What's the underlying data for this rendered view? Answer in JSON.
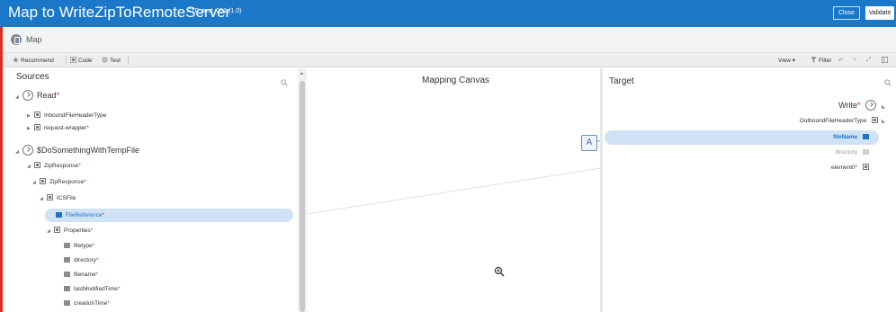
{
  "header": {
    "title": "Map to WriteZipToRemoteServer",
    "subtitle": "FTP_test_001 (1.0)",
    "close_label": "Close",
    "validate_label": "Validate",
    "accent_color": "#1b78c9"
  },
  "mapbar": {
    "label": "Map",
    "icon": "map-icon"
  },
  "toolbar": {
    "recommend": "Recommend",
    "code": "Code",
    "test": "Test",
    "view": "View",
    "filter": "Filter",
    "icons": [
      "star-icon",
      "code-icon",
      "gear-icon",
      "filter-icon",
      "undo-icon",
      "redo-icon",
      "expand-icon",
      "panel-icon"
    ]
  },
  "sources": {
    "title": "Sources",
    "items": [
      {
        "label": "Read",
        "required": "*"
      },
      {
        "label": "InboundFileHeaderType",
        "required": ""
      },
      {
        "label": "request-wrapper",
        "required": "*"
      },
      {
        "label": "$DoSomethingWithTempFile",
        "required": ""
      },
      {
        "label": "ZipResponse",
        "required": "*"
      },
      {
        "label": "ZipResponse",
        "required": "*"
      },
      {
        "label": "ICSFile",
        "required": ""
      },
      {
        "label": "FileReference",
        "required": "*"
      },
      {
        "label": "Properties",
        "required": "*"
      },
      {
        "label": "filetype",
        "required": "*"
      },
      {
        "label": "directory",
        "required": "*"
      },
      {
        "label": "filename",
        "required": "*"
      },
      {
        "label": "lastModifiedTime",
        "required": "*"
      },
      {
        "label": "creationTime",
        "required": "*"
      }
    ]
  },
  "canvas": {
    "title": "Mapping Canvas",
    "function_label": "A"
  },
  "target": {
    "title": "Target",
    "items": [
      {
        "label": "Write",
        "required": "*"
      },
      {
        "label": "OutboundFileHeaderType",
        "required": ""
      },
      {
        "label": "fileName",
        "required": ""
      },
      {
        "label": "directory",
        "required": ""
      },
      {
        "label": "element0",
        "required": "*"
      }
    ]
  }
}
